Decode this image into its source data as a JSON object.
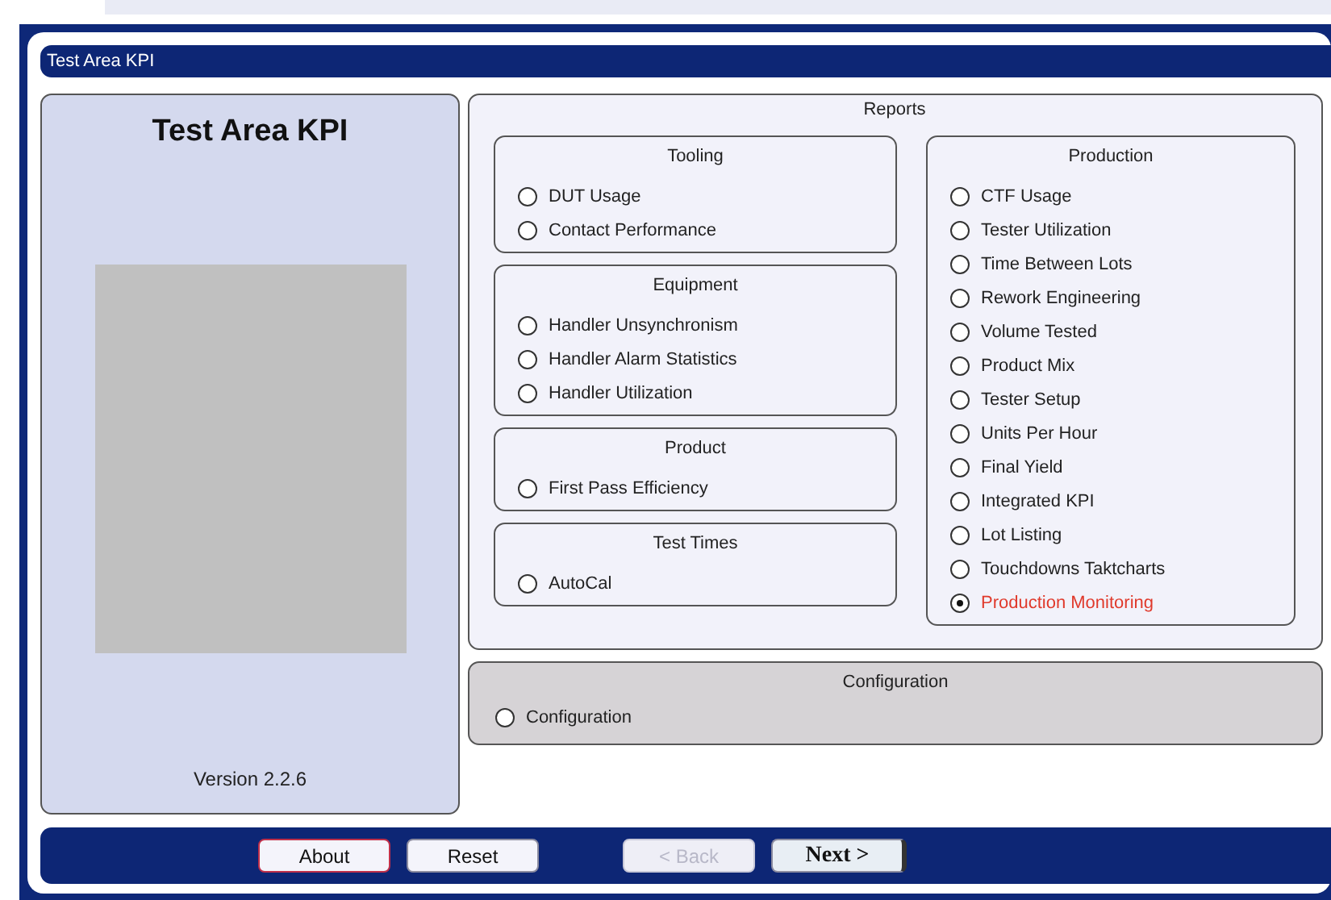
{
  "window": {
    "title": "Test Area KPI"
  },
  "sidebar": {
    "heading": "Test Area KPI",
    "version": "Version 2.2.6"
  },
  "reports": {
    "title": "Reports",
    "left_groups": [
      {
        "title": "Tooling",
        "options": [
          {
            "label": "DUT Usage",
            "selected": false
          },
          {
            "label": "Contact Performance",
            "selected": false
          }
        ]
      },
      {
        "title": "Equipment",
        "options": [
          {
            "label": "Handler Unsynchronism",
            "selected": false
          },
          {
            "label": "Handler Alarm Statistics",
            "selected": false
          },
          {
            "label": "Handler Utilization",
            "selected": false
          }
        ]
      },
      {
        "title": "Product",
        "options": [
          {
            "label": "First Pass Efficiency",
            "selected": false
          }
        ]
      },
      {
        "title": "Test Times",
        "options": [
          {
            "label": "AutoCal",
            "selected": false
          }
        ]
      }
    ],
    "right_groups": [
      {
        "title": "Production",
        "options": [
          {
            "label": "CTF Usage",
            "selected": false
          },
          {
            "label": "Tester Utilization",
            "selected": false
          },
          {
            "label": "Time Between Lots",
            "selected": false
          },
          {
            "label": "Rework Engineering",
            "selected": false
          },
          {
            "label": "Volume Tested",
            "selected": false
          },
          {
            "label": "Product Mix",
            "selected": false
          },
          {
            "label": "Tester Setup",
            "selected": false
          },
          {
            "label": "Units Per Hour",
            "selected": false
          },
          {
            "label": "Final Yield",
            "selected": false
          },
          {
            "label": "Integrated KPI",
            "selected": false
          },
          {
            "label": "Lot Listing",
            "selected": false
          },
          {
            "label": "Touchdowns Taktcharts",
            "selected": false
          },
          {
            "label": "Production Monitoring",
            "selected": true
          }
        ]
      }
    ]
  },
  "configuration": {
    "title": "Configuration",
    "options": [
      {
        "label": "Configuration",
        "selected": false
      }
    ]
  },
  "buttons": [
    {
      "label": "About",
      "focused": true,
      "disabled": false,
      "default": false
    },
    {
      "label": "Reset",
      "focused": false,
      "disabled": false,
      "default": false
    },
    {
      "label": "< Back",
      "focused": false,
      "disabled": true,
      "default": false
    },
    {
      "label": "Next >",
      "focused": false,
      "disabled": false,
      "default": true
    }
  ]
}
